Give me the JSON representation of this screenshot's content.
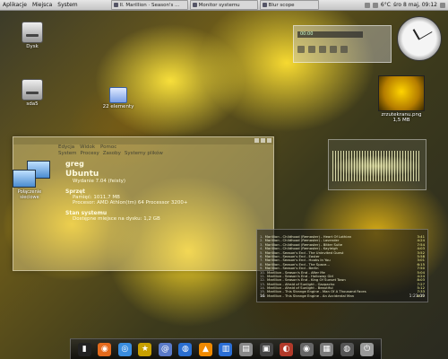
{
  "top_panel": {
    "menus": [
      "Aplikacje",
      "Miejsca",
      "System"
    ],
    "tasks": [
      {
        "label": "II. Marillion · Season's ..."
      },
      {
        "label": "Monitor systemu"
      },
      {
        "label": "Blur scope"
      }
    ],
    "tray": {
      "weather": "6°C",
      "datetime": "śro 8 maj, 09:12"
    }
  },
  "desktop_icons": [
    {
      "label": "Dysk"
    },
    {
      "label": "sda5"
    },
    {
      "label": "22 elementy"
    },
    {
      "label": "zrzutekranu.png"
    },
    {
      "label": "1,5 MB"
    }
  ],
  "system_monitor": {
    "menu": [
      "Edycja",
      "Widok",
      "Pomoc"
    ],
    "tabs": [
      "System",
      "Procesy",
      "Zasoby",
      "Systemy plików"
    ],
    "hostname": "greg",
    "os_name": "Ubuntu",
    "os_version": "Wydanie 7.04 (feisty)",
    "hardware_title": "Sprzęt",
    "memory": "Pamięć:  1011,7 MB",
    "processor": "Procesor:  AMD Athlon(tm) 64 Processor 3200+",
    "status_title": "Stan systemu",
    "disk_space": "Dostępne miejsce na dysku:  1,2 GB"
  },
  "network_widget": {
    "label": "Połączenie sieciowe"
  },
  "player": {
    "display": "00:00",
    "playlist": [
      {
        "n": "1.",
        "title": "Marillion - Childhood (Remaster) - Heart Of Lothian",
        "d": "3:41"
      },
      {
        "n": "2.",
        "title": "Marillion - Childhood (Remaster) - Lavender",
        "d": "4:24"
      },
      {
        "n": "3.",
        "title": "Marillion - Childhood (Remaster) - Bitter Suite",
        "d": "7:54"
      },
      {
        "n": "4.",
        "title": "Marillion - Childhood (Remaster) - Kayleigh",
        "d": "4:03"
      },
      {
        "n": "5.",
        "title": "Marillion - Season's End - The Uninvited Guest",
        "d": "3:52"
      },
      {
        "n": "6.",
        "title": "Marillion - Season's End - Easter",
        "d": "5:58"
      },
      {
        "n": "7.",
        "title": "Marillion - Season's End - Hooks In You",
        "d": "3:01"
      },
      {
        "n": "8.",
        "title": "Marillion - Season's End - The Space...",
        "d": "6:15"
      },
      {
        "n": "9.",
        "title": "Marillion - Season's End - Berlin",
        "d": "7:50"
      },
      {
        "n": "10.",
        "title": "Marillion - Season's End - After Me",
        "d": "5:04"
      },
      {
        "n": "11.",
        "title": "Marillion - Season's End - Holloway Girl",
        "d": "4:24"
      },
      {
        "n": "12.",
        "title": "Marillion - Season's End - King Of Sunset Town",
        "d": "8:03"
      },
      {
        "n": "13.",
        "title": "Marillion - Afraid of Sunlight - Gazpacho",
        "d": "7:27"
      },
      {
        "n": "14.",
        "title": "Marillion - Afraid of Sunlight - Beautiful",
        "d": "5:12"
      },
      {
        "n": "15.",
        "title": "Marillion - This Strange Engine - Man Of A Thousand Faces",
        "d": "7:33"
      },
      {
        "n": "16.",
        "title": "Marillion - This Strange Engine - An Accidental Man",
        "d": "6:12"
      }
    ],
    "footer_count": "16",
    "footer_time": "1:21:09"
  },
  "dock": {
    "items": [
      "terminal-icon",
      "firefox-icon",
      "network-icon",
      "star-icon",
      "mail-icon",
      "globe-icon",
      "vlc-icon",
      "library-icon",
      "text-editor-icon",
      "camera-icon",
      "media-icon",
      "burner-icon",
      "gallery-icon",
      "trash-icon",
      "power-icon"
    ]
  }
}
